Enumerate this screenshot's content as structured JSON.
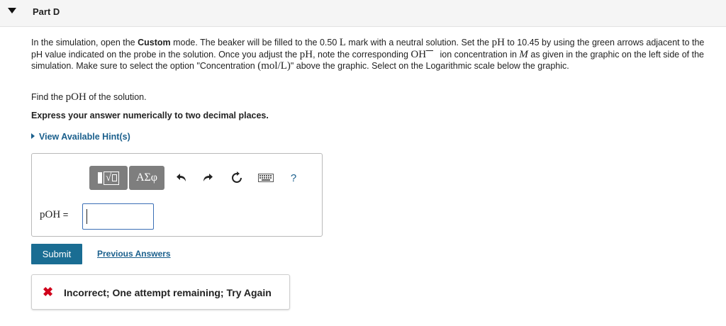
{
  "part": {
    "title": "Part D"
  },
  "instructions": {
    "t1": "In the simulation, open the ",
    "t2": "Custom",
    "t3": " mode. The beaker will be filled to the 0.50 ",
    "t4": "L",
    "t5": " mark with a neutral solution. Set the ",
    "t6": "pH",
    "t7": " to 10.45 by using the green arrows adjacent to the pH value indicated on the probe in the solution. Once you adjust the ",
    "t8": "pH",
    "t9": ", note the corresponding ",
    "t10": "OH",
    "t11": " ion concentration in ",
    "t12": "M",
    "t13": " as given in the graphic on the left side of the simulation. Make sure to select the option \"Concentration ",
    "t14": "(mol/L)",
    "t15": "\" above the graphic. Select on the Logarithmic scale below the graphic."
  },
  "question": {
    "prefix": "Find the ",
    "symbol": "pOH",
    "suffix": " of the solution."
  },
  "express": "Express your answer numerically to two decimal places.",
  "hints": {
    "label": "View Available Hint(s)"
  },
  "toolbar": {
    "greek_label": "ΑΣφ",
    "help_label": "?"
  },
  "answer": {
    "label": "pOH",
    "equals": " =",
    "value": ""
  },
  "actions": {
    "submit_label": "Submit",
    "previous_label": "Previous Answers"
  },
  "feedback": {
    "text": "Incorrect; One attempt remaining; Try Again",
    "icon": "x-icon"
  },
  "colors": {
    "accent": "#1a5f8c",
    "submit_bg": "#1a6d93",
    "error": "#d0021b",
    "toolbar_btn": "#7e7e7e"
  }
}
